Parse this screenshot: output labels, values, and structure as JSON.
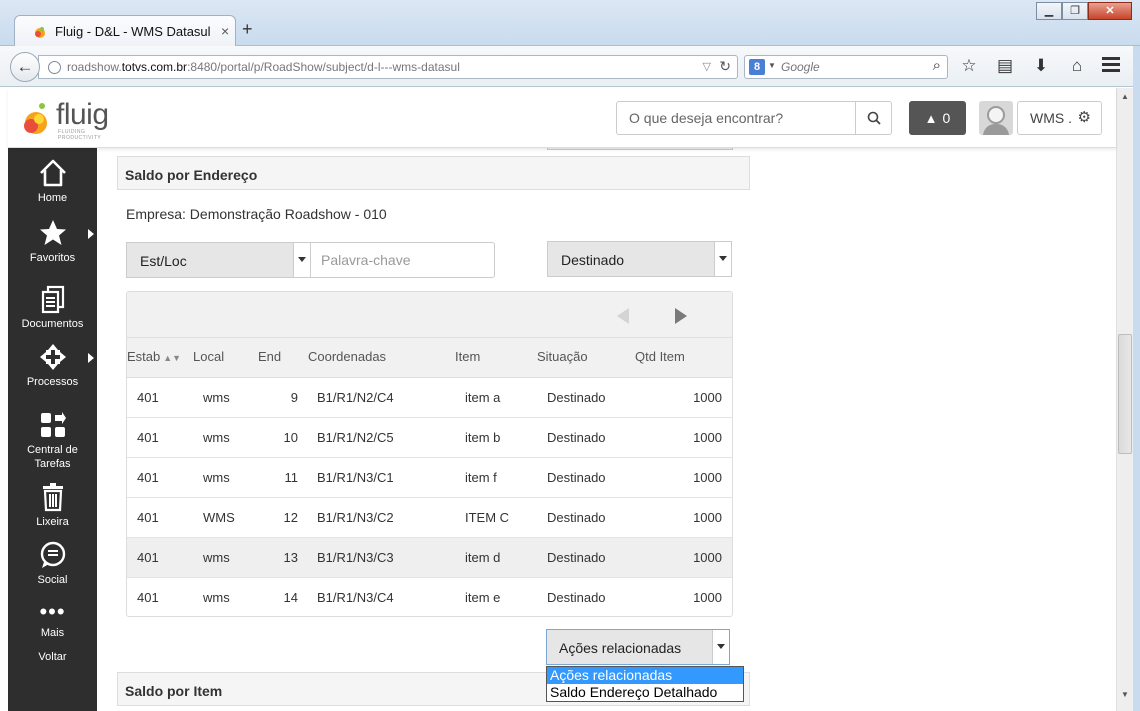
{
  "browser": {
    "tab_title": "Fluig - D&L - WMS Datasul",
    "tab_close": "×",
    "new_tab": "+",
    "url_prefix": "roadshow.",
    "url_host": "totvs.com.br",
    "url_rest": ":8480/portal/p/RoadShow/subject/d-l---wms-datasul",
    "search_engine": "8",
    "search_placeholder": "Google",
    "back_glyph": "←",
    "reload_glyph": "↻",
    "dropdown_glyph": "▽",
    "min_glyph": "▁",
    "max_glyph": "❐",
    "close_glyph": "✕"
  },
  "header": {
    "logo_text": "fluig",
    "logo_tagline": "FLUIDING PRODUCTIVITY",
    "search_placeholder": "O que deseja encontrar?",
    "notification_count": "0",
    "user_label": "WMS ."
  },
  "sidebar": {
    "items": [
      {
        "label": "Home",
        "icon": "home-icon"
      },
      {
        "label": "Favoritos",
        "icon": "star-icon"
      },
      {
        "label": "Documentos",
        "icon": "documents-icon"
      },
      {
        "label": "Processos",
        "icon": "processes-icon"
      },
      {
        "label": "Central de Tarefas",
        "icon": "tasks-icon"
      },
      {
        "label": "Lixeira",
        "icon": "trash-icon"
      },
      {
        "label": "Social",
        "icon": "social-icon"
      },
      {
        "label": "Mais",
        "icon": "more-icon"
      },
      {
        "label": "Voltar",
        "icon": ""
      }
    ]
  },
  "panel": {
    "title": "Saldo por Endereço",
    "empresa": "Empresa: Demonstração Roadshow - 010",
    "filter_field": "Est/Loc",
    "keyword_placeholder": "Palavra-chave",
    "status_filter": "Destinado"
  },
  "table": {
    "columns": [
      "Estab",
      "Local",
      "End",
      "Coordenadas",
      "Item",
      "Situação",
      "Qtd Item"
    ],
    "sort_indicator": "▲▼",
    "rows": [
      [
        "401",
        "wms",
        "9",
        "B1/R1/N2/C4",
        "item a",
        "Destinado",
        "1000"
      ],
      [
        "401",
        "wms",
        "10",
        "B1/R1/N2/C5",
        "item b",
        "Destinado",
        "1000"
      ],
      [
        "401",
        "wms",
        "11",
        "B1/R1/N3/C1",
        "item f",
        "Destinado",
        "1000"
      ],
      [
        "401",
        "WMS",
        "12",
        "B1/R1/N3/C2",
        "ITEM C",
        "Destinado",
        "1000"
      ],
      [
        "401",
        "wms",
        "13",
        "B1/R1/N3/C3",
        "item d",
        "Destinado",
        "1000"
      ],
      [
        "401",
        "wms",
        "14",
        "B1/R1/N3/C4",
        "item e",
        "Destinado",
        "1000"
      ]
    ]
  },
  "actions": {
    "selected": "Ações relacionadas",
    "options": [
      "Ações relacionadas",
      "Saldo Endereço Detalhado"
    ]
  },
  "next_panel": {
    "title": "Saldo por Item"
  }
}
